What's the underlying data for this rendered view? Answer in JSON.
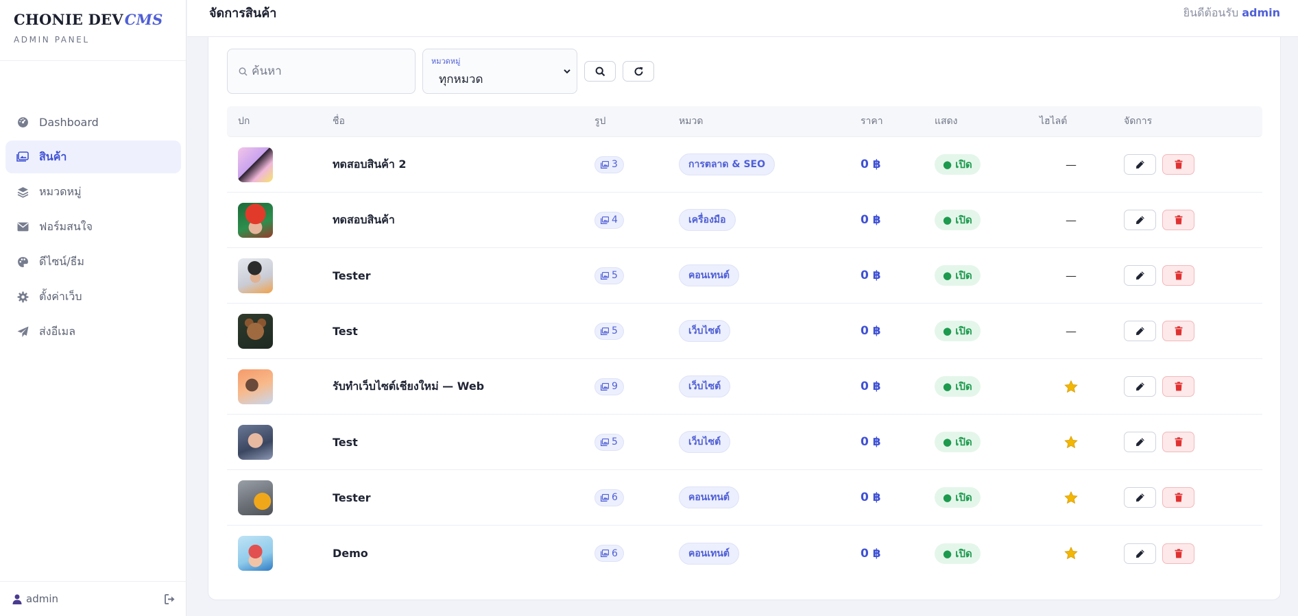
{
  "brand": {
    "name": "CHONIE DEV",
    "accent": "CMS",
    "subtitle": "ADMIN PANEL"
  },
  "sidebar": {
    "items": [
      {
        "label": "Dashboard",
        "icon": "gauge-icon",
        "active": false
      },
      {
        "label": "สินค้า",
        "icon": "images-icon",
        "active": true
      },
      {
        "label": "หมวดหมู่",
        "icon": "layers-icon",
        "active": false
      },
      {
        "label": "ฟอร์มสนใจ",
        "icon": "envelope-icon",
        "active": false
      },
      {
        "label": "ดีไซน์/ธีม",
        "icon": "palette-icon",
        "active": false
      },
      {
        "label": "ตั้งค่าเว็บ",
        "icon": "gear-icon",
        "active": false
      },
      {
        "label": "ส่งอีเมล",
        "icon": "paper-plane-icon",
        "active": false
      }
    ],
    "footer_user": "admin"
  },
  "header": {
    "title": "จัดการสินค้า",
    "welcome": "ยินดีต้อนรับ",
    "user": "admin"
  },
  "filters": {
    "search_placeholder": "ค้นหา",
    "category_label": "หมวดหมู่",
    "category_value": "ทุกหมวด"
  },
  "table": {
    "headers": {
      "cover": "ปก",
      "name": "ชื่อ",
      "images": "รูป",
      "category": "หมวด",
      "price": "ราคา",
      "show": "แสดง",
      "highlight": "ไฮไลต์",
      "actions": "จัดการ"
    },
    "rows": [
      {
        "name": "ทดสอบสินค้า 2",
        "images": "3",
        "category": "การตลาด & SEO",
        "price": "0 ฿",
        "status": "● เปิด",
        "highlight": "—",
        "starred": false
      },
      {
        "name": "ทดสอบสินค้า",
        "images": "4",
        "category": "เครื่องมือ",
        "price": "0 ฿",
        "status": "● เปิด",
        "highlight": "—",
        "starred": false
      },
      {
        "name": "Tester",
        "images": "5",
        "category": "คอนเทนต์",
        "price": "0 ฿",
        "status": "● เปิด",
        "highlight": "—",
        "starred": false
      },
      {
        "name": "Test",
        "images": "5",
        "category": "เว็บไซต์",
        "price": "0 ฿",
        "status": "● เปิด",
        "highlight": "—",
        "starred": false
      },
      {
        "name": "รับทำเว็บไซต์เชียงใหม่ — Web",
        "images": "9",
        "category": "เว็บไซต์",
        "price": "0 ฿",
        "status": "● เปิด",
        "highlight": "",
        "starred": true
      },
      {
        "name": "Test",
        "images": "5",
        "category": "เว็บไซต์",
        "price": "0 ฿",
        "status": "● เปิด",
        "highlight": "",
        "starred": true
      },
      {
        "name": "Tester",
        "images": "6",
        "category": "คอนเทนต์",
        "price": "0 ฿",
        "status": "● เปิด",
        "highlight": "",
        "starred": true
      },
      {
        "name": "Demo",
        "images": "6",
        "category": "คอนเทนต์",
        "price": "0 ฿",
        "status": "● เปิด",
        "highlight": "",
        "starred": true
      }
    ]
  },
  "colors": {
    "accent": "#4f5fd6",
    "success": "#1d9a4e",
    "danger": "#e03131",
    "star": "#f2b705"
  }
}
